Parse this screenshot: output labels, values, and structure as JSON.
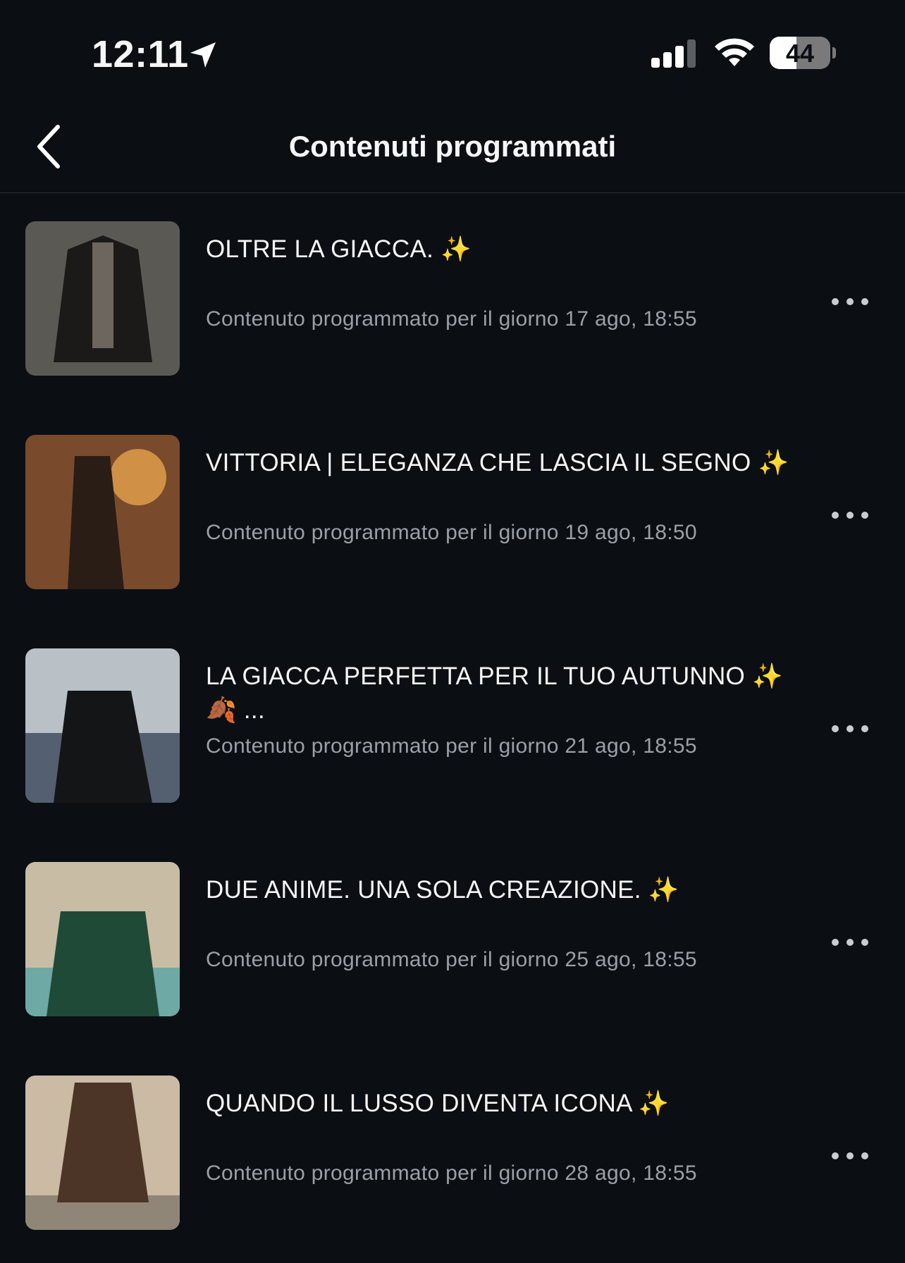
{
  "status_bar": {
    "time": "12:11",
    "battery_percent": 44,
    "battery_label": "44"
  },
  "nav": {
    "title": "Contenuti programmati"
  },
  "items": [
    {
      "title": "OLTRE LA GIACCA. ✨",
      "subtitle": "Contenuto programmato per il giorno 17 ago, 18:55",
      "thumbnail_colors": [
        "#5b5954",
        "#1c1a18",
        "#8e877c"
      ]
    },
    {
      "title": "VITTORIA | ELEGANZA CHE LASCIA IL SEGNO ✨",
      "subtitle": "Contenuto programmato per il giorno 19 ago, 18:50",
      "thumbnail_colors": [
        "#7a4a2c",
        "#2a1d16",
        "#e6a24e"
      ]
    },
    {
      "title": "LA GIACCA PERFETTA PER IL TUO AUTUNNO ✨",
      "title_line2": "🍂 ...",
      "subtitle": "Contenuto programmato per il giorno 21 ago, 18:55",
      "thumbnail_colors": [
        "#b9c0c6",
        "#141516",
        "#546070"
      ]
    },
    {
      "title": "DUE ANIME. UNA SOLA CREAZIONE. ✨",
      "subtitle": "Contenuto programmato per il giorno 25 ago, 18:55",
      "thumbnail_colors": [
        "#c9bca4",
        "#1f4a37",
        "#6fa9a5"
      ]
    },
    {
      "title": "QUANDO IL LUSSO DIVENTA ICONA ✨",
      "subtitle": "Contenuto programmato per il giorno 28 ago, 18:55",
      "thumbnail_colors": [
        "#cbbba5",
        "#4c3526",
        "#8f8678"
      ]
    }
  ]
}
